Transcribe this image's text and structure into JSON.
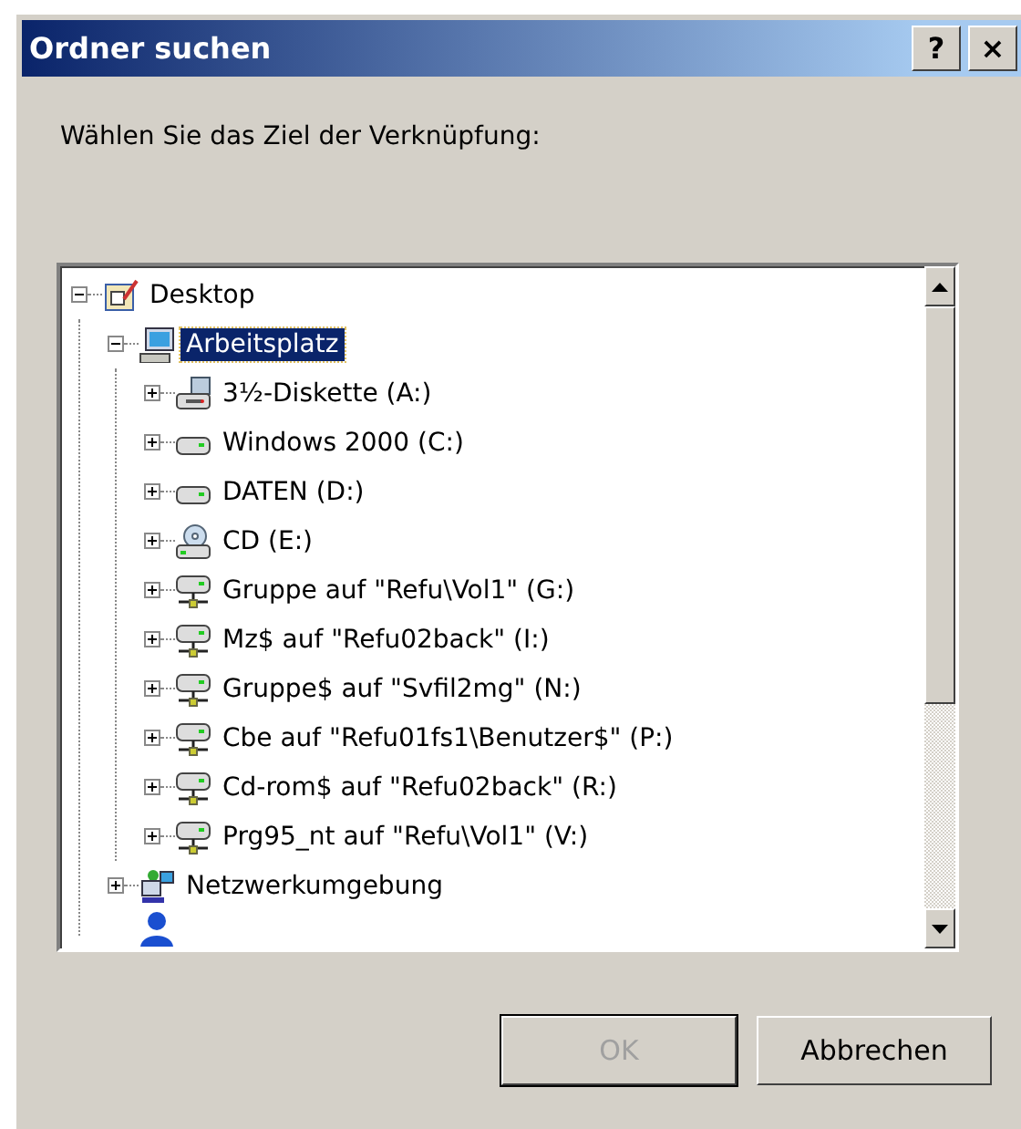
{
  "window": {
    "title": "Ordner suchen",
    "controls": [
      "?",
      "×"
    ]
  },
  "prompt": "Wählen Sie das Ziel der Verknüpfung:",
  "tree": [
    {
      "label": "Desktop",
      "kind": "desktop",
      "expanded": true,
      "selected": false,
      "children": [
        {
          "label": "Arbeitsplatz",
          "kind": "computer",
          "expanded": true,
          "selected": true,
          "children": [
            {
              "label": "3½-Diskette (A:)",
              "kind": "floppy",
              "expanded": false,
              "selected": false
            },
            {
              "label": "Windows 2000 (C:)",
              "kind": "drive",
              "expanded": false,
              "selected": false
            },
            {
              "label": "DATEN (D:)",
              "kind": "drive",
              "expanded": false,
              "selected": false
            },
            {
              "label": "CD (E:)",
              "kind": "cd",
              "expanded": false,
              "selected": false
            },
            {
              "label": "Gruppe auf \"Refu\\Vol1\" (G:)",
              "kind": "netdrive",
              "expanded": false,
              "selected": false
            },
            {
              "label": "Mz$ auf \"Refu02back\" (I:)",
              "kind": "netdrive",
              "expanded": false,
              "selected": false
            },
            {
              "label": "Gruppe$ auf \"Svfil2mg\" (N:)",
              "kind": "netdrive",
              "expanded": false,
              "selected": false
            },
            {
              "label": "Cbe auf \"Refu01fs1\\Benutzer$\" (P:)",
              "kind": "netdrive",
              "expanded": false,
              "selected": false
            },
            {
              "label": "Cd-rom$ auf \"Refu02back\" (R:)",
              "kind": "netdrive",
              "expanded": false,
              "selected": false
            },
            {
              "label": "Prg95_nt auf \"Refu\\Vol1\" (V:)",
              "kind": "netdrive",
              "expanded": false,
              "selected": false
            }
          ]
        },
        {
          "label": "Netzwerkumgebung",
          "kind": "network",
          "expanded": false,
          "selected": false
        }
      ]
    }
  ],
  "buttons": [
    {
      "label": "OK",
      "disabled": true
    },
    {
      "label": "Abbrechen",
      "disabled": false
    }
  ]
}
